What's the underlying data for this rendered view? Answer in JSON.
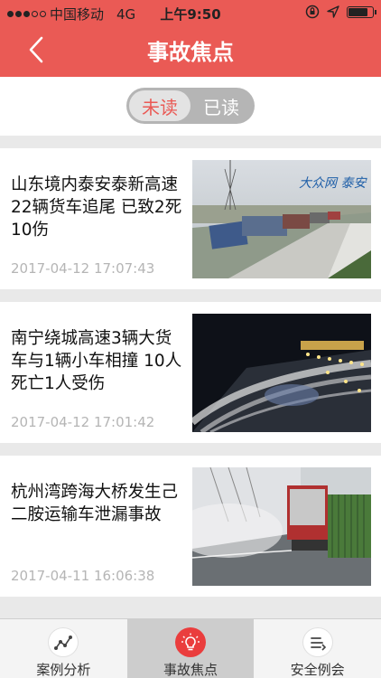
{
  "status": {
    "carrier": "中国移动",
    "network": "4G",
    "time": "上午9:50",
    "battery_level": 0.85
  },
  "nav": {
    "title": "事故焦点",
    "back_icon": "chevron-left-icon"
  },
  "segment": {
    "unread": "未读",
    "read": "已读",
    "selected": "未读"
  },
  "news": [
    {
      "title": "山东境内泰安泰新高速22辆货车追尾 已致2死10伤",
      "date": "2017-04-12 17:07:43",
      "watermark": "大众网 泰安"
    },
    {
      "title": "南宁绕城高速3辆大货车与1辆小车相撞 10人死亡1人受伤",
      "date": "2017-04-12 17:01:42",
      "caption": ""
    },
    {
      "title": "杭州湾跨海大桥发生己二胺运输车泄漏事故",
      "date": "2017-04-11 16:06:38"
    }
  ],
  "tabs": [
    {
      "label": "案例分析",
      "icon": "trend-chart-icon"
    },
    {
      "label": "事故焦点",
      "icon": "lightbulb-icon"
    },
    {
      "label": "安全例会",
      "icon": "list-menu-icon"
    }
  ],
  "colors": {
    "brand": "#ea5a55",
    "active_tab_icon": "#ea3d3d"
  }
}
